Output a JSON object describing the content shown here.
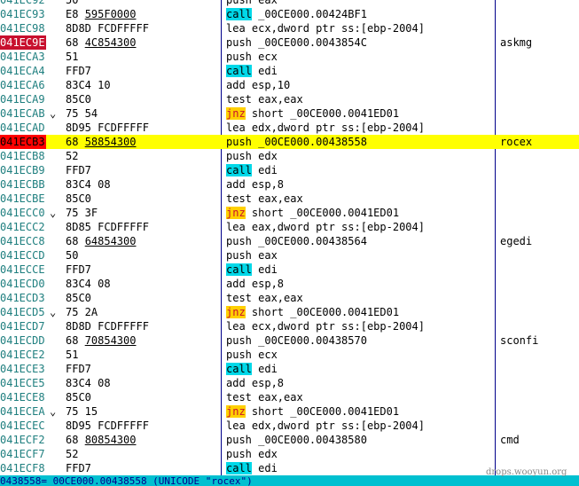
{
  "rows": [
    {
      "addr": "041EC92",
      "jmark": "",
      "hex": "50",
      "hex_u": "",
      "asm_kw": "",
      "asm": "push eax",
      "comment": ""
    },
    {
      "addr": "041EC93",
      "jmark": "",
      "hex": "E8 ",
      "hex_u": "595F0000",
      "asm_kw": "call",
      "asm": " _00CE000.00424BF1",
      "comment": ""
    },
    {
      "addr": "041EC98",
      "jmark": "",
      "hex": "8D8D FCDFFFFF",
      "hex_u": "",
      "asm_kw": "",
      "asm": "lea ecx,dword ptr ss:[ebp-2004]",
      "comment": ""
    },
    {
      "addr": "041EC9E",
      "jmark": "",
      "hex": "68 ",
      "hex_u": "4C854300",
      "asm_kw": "",
      "asm": "push _00CE000.0043854C",
      "comment": "askmg",
      "addr_hl": true
    },
    {
      "addr": "041ECA3",
      "jmark": "",
      "hex": "51",
      "hex_u": "",
      "asm_kw": "",
      "asm": "push ecx",
      "comment": ""
    },
    {
      "addr": "041ECA4",
      "jmark": "",
      "hex": "FFD7",
      "hex_u": "",
      "asm_kw": "call",
      "asm": " edi",
      "comment": ""
    },
    {
      "addr": "041ECA6",
      "jmark": "",
      "hex": "83C4 10",
      "hex_u": "",
      "asm_kw": "",
      "asm": "add esp,10",
      "comment": ""
    },
    {
      "addr": "041ECA9",
      "jmark": "",
      "hex": "85C0",
      "hex_u": "",
      "asm_kw": "",
      "asm": "test eax,eax",
      "comment": ""
    },
    {
      "addr": "041ECAB",
      "jmark": "⌄",
      "hex": "75 54",
      "hex_u": "",
      "asm_kw": "jnz",
      "asm": " short _00CE000.0041ED01",
      "comment": ""
    },
    {
      "addr": "041ECAD",
      "jmark": "",
      "hex": "8D95 FCDFFFFF",
      "hex_u": "",
      "asm_kw": "",
      "asm": "lea edx,dword ptr ss:[ebp-2004]",
      "comment": ""
    },
    {
      "addr": "041ECB3",
      "jmark": "",
      "hex": "68 ",
      "hex_u": "58854300",
      "asm_kw": "",
      "asm": "push _00CE000.00438558",
      "comment": "rocex",
      "selected": true
    },
    {
      "addr": "041ECB8",
      "jmark": "",
      "hex": "52",
      "hex_u": "",
      "asm_kw": "",
      "asm": "push edx",
      "comment": ""
    },
    {
      "addr": "041ECB9",
      "jmark": "",
      "hex": "FFD7",
      "hex_u": "",
      "asm_kw": "call",
      "asm": " edi",
      "comment": ""
    },
    {
      "addr": "041ECBB",
      "jmark": "",
      "hex": "83C4 08",
      "hex_u": "",
      "asm_kw": "",
      "asm": "add esp,8",
      "comment": ""
    },
    {
      "addr": "041ECBE",
      "jmark": "",
      "hex": "85C0",
      "hex_u": "",
      "asm_kw": "",
      "asm": "test eax,eax",
      "comment": ""
    },
    {
      "addr": "041ECC0",
      "jmark": "⌄",
      "hex": "75 3F",
      "hex_u": "",
      "asm_kw": "jnz",
      "asm": " short _00CE000.0041ED01",
      "comment": ""
    },
    {
      "addr": "041ECC2",
      "jmark": "",
      "hex": "8D85 FCDFFFFF",
      "hex_u": "",
      "asm_kw": "",
      "asm": "lea eax,dword ptr ss:[ebp-2004]",
      "comment": ""
    },
    {
      "addr": "041ECC8",
      "jmark": "",
      "hex": "68 ",
      "hex_u": "64854300",
      "asm_kw": "",
      "asm": "push _00CE000.00438564",
      "comment": "egedi"
    },
    {
      "addr": "041ECCD",
      "jmark": "",
      "hex": "50",
      "hex_u": "",
      "asm_kw": "",
      "asm": "push eax",
      "comment": ""
    },
    {
      "addr": "041ECCE",
      "jmark": "",
      "hex": "FFD7",
      "hex_u": "",
      "asm_kw": "call",
      "asm": " edi",
      "comment": ""
    },
    {
      "addr": "041ECD0",
      "jmark": "",
      "hex": "83C4 08",
      "hex_u": "",
      "asm_kw": "",
      "asm": "add esp,8",
      "comment": ""
    },
    {
      "addr": "041ECD3",
      "jmark": "",
      "hex": "85C0",
      "hex_u": "",
      "asm_kw": "",
      "asm": "test eax,eax",
      "comment": ""
    },
    {
      "addr": "041ECD5",
      "jmark": "⌄",
      "hex": "75 2A",
      "hex_u": "",
      "asm_kw": "jnz",
      "asm": " short _00CE000.0041ED01",
      "comment": ""
    },
    {
      "addr": "041ECD7",
      "jmark": "",
      "hex": "8D8D FCDFFFFF",
      "hex_u": "",
      "asm_kw": "",
      "asm": "lea ecx,dword ptr ss:[ebp-2004]",
      "comment": ""
    },
    {
      "addr": "041ECDD",
      "jmark": "",
      "hex": "68 ",
      "hex_u": "70854300",
      "asm_kw": "",
      "asm": "push _00CE000.00438570",
      "comment": "sconfi"
    },
    {
      "addr": "041ECE2",
      "jmark": "",
      "hex": "51",
      "hex_u": "",
      "asm_kw": "",
      "asm": "push ecx",
      "comment": ""
    },
    {
      "addr": "041ECE3",
      "jmark": "",
      "hex": "FFD7",
      "hex_u": "",
      "asm_kw": "call",
      "asm": " edi",
      "comment": ""
    },
    {
      "addr": "041ECE5",
      "jmark": "",
      "hex": "83C4 08",
      "hex_u": "",
      "asm_kw": "",
      "asm": "add esp,8",
      "comment": ""
    },
    {
      "addr": "041ECE8",
      "jmark": "",
      "hex": "85C0",
      "hex_u": "",
      "asm_kw": "",
      "asm": "test eax,eax",
      "comment": ""
    },
    {
      "addr": "041ECEA",
      "jmark": "⌄",
      "hex": "75 15",
      "hex_u": "",
      "asm_kw": "jnz",
      "asm": " short _00CE000.0041ED01",
      "comment": ""
    },
    {
      "addr": "041ECEC",
      "jmark": "",
      "hex": "8D95 FCDFFFFF",
      "hex_u": "",
      "asm_kw": "",
      "asm": "lea edx,dword ptr ss:[ebp-2004]",
      "comment": ""
    },
    {
      "addr": "041ECF2",
      "jmark": "",
      "hex": "68 ",
      "hex_u": "80854300",
      "asm_kw": "",
      "asm": "push _00CE000.00438580",
      "comment": "cmd"
    },
    {
      "addr": "041ECF7",
      "jmark": "",
      "hex": "52",
      "hex_u": "",
      "asm_kw": "",
      "asm": "push edx",
      "comment": ""
    },
    {
      "addr": "041ECF8",
      "jmark": "",
      "hex": "FFD7",
      "hex_u": "",
      "asm_kw": "call",
      "asm": " edi",
      "comment": ""
    }
  ],
  "status_text": "0438558=_00CE000.00438558 (UNICODE \"rocex\")",
  "watermark": "drops.wooyun.org",
  "colors": {
    "address": "#1f7f7f",
    "address_highlight": "#c8102e",
    "selection": "#ffff00",
    "call_bg": "#00d8e8",
    "jnz_bg": "#ffd000",
    "jnz_fg": "#c8102e",
    "status_bg": "#00c0d0",
    "divider": "#00008b"
  }
}
